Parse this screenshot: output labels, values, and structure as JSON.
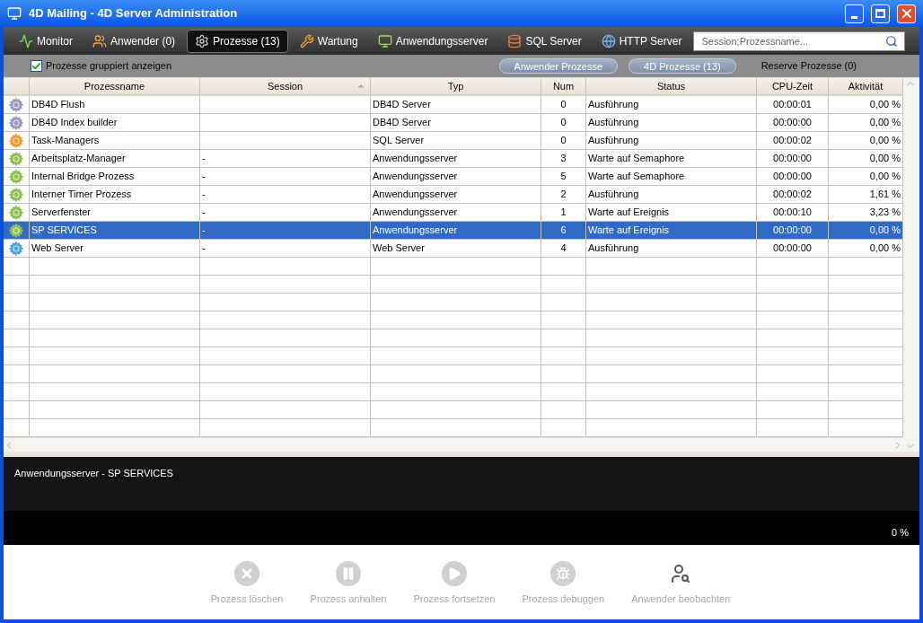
{
  "window": {
    "title": "4D Mailing - 4D Server Administration"
  },
  "tabs": [
    {
      "label": "Monitor",
      "kind": "monitor",
      "selected": false
    },
    {
      "label": "Anwender (0)",
      "kind": "users",
      "selected": false
    },
    {
      "label": "Prozesse (13)",
      "kind": "gear",
      "selected": true
    },
    {
      "label": "Wartung",
      "kind": "tools",
      "selected": false
    },
    {
      "label": "Anwendungsserver",
      "kind": "app",
      "selected": false
    },
    {
      "label": "SQL Server",
      "kind": "sql",
      "selected": false
    },
    {
      "label": "HTTP Server",
      "kind": "web",
      "selected": false
    }
  ],
  "search": {
    "placeholder": "Session;Prozessname..."
  },
  "group_option": {
    "label": "Prozesse gruppiert anzeigen",
    "checked": true
  },
  "filters": [
    {
      "label": "Anwender Prozesse",
      "kind": "pill"
    },
    {
      "label": "4D Prozesse (13)",
      "kind": "pill"
    },
    {
      "label": "Reserve Prozesse (0)",
      "kind": "text"
    }
  ],
  "table": {
    "columns": [
      {
        "label": "Prozessname",
        "sorted": false
      },
      {
        "label": "Session",
        "sorted": true
      },
      {
        "label": "Typ",
        "sorted": false
      },
      {
        "label": "Num",
        "sorted": false
      },
      {
        "label": "Status",
        "sorted": false
      },
      {
        "label": "CPU-Zeit",
        "sorted": false
      },
      {
        "label": "Aktivität",
        "sorted": false
      }
    ],
    "rows": [
      {
        "color": "#9a9ac0",
        "selected": false,
        "cells": [
          "DB4D Flush",
          "",
          "DB4D Server",
          "0",
          "Ausführung",
          "00:00:01",
          "0,00 %"
        ]
      },
      {
        "color": "#9a9ac0",
        "selected": false,
        "cells": [
          "DB4D Index builder",
          "",
          "DB4D Server",
          "0",
          "Ausführung",
          "00:00:00",
          "0,00 %"
        ]
      },
      {
        "color": "#f29a2e",
        "selected": false,
        "cells": [
          "Task-Managers",
          "",
          "SQL Server",
          "0",
          "Ausführung",
          "00:00:02",
          "0,00 %"
        ]
      },
      {
        "color": "#8cc152",
        "selected": false,
        "cells": [
          "Arbeitsplatz-Manager",
          "-",
          "Anwendungsserver",
          "3",
          "Warte auf Semaphore",
          "00:00:00",
          "0,00 %"
        ]
      },
      {
        "color": "#8cc152",
        "selected": false,
        "cells": [
          "Internal Bridge Prozess",
          "-",
          "Anwendungsserver",
          "5",
          "Warte auf Semaphore",
          "00:00:00",
          "0,00 %"
        ]
      },
      {
        "color": "#8cc152",
        "selected": false,
        "cells": [
          "Interner Timer Prozess",
          "-",
          "Anwendungsserver",
          "2",
          "Ausführung",
          "00:00:02",
          "1,61 %"
        ]
      },
      {
        "color": "#8cc152",
        "selected": false,
        "cells": [
          "Serverfenster",
          "-",
          "Anwendungsserver",
          "1",
          "Warte auf Ereignis",
          "00:00:10",
          "3,23 %"
        ]
      },
      {
        "color": "#8cc152",
        "selected": true,
        "cells": [
          "SP SERVICES",
          "-",
          "Anwendungsserver",
          "6",
          "Warte auf Ereignis",
          "00:00:00",
          "0,00 %"
        ]
      },
      {
        "color": "#4aa6e0",
        "selected": false,
        "cells": [
          "Web Server",
          "-",
          "Web Server",
          "4",
          "Ausführung",
          "00:00:00",
          "0,00 %"
        ]
      }
    ]
  },
  "details": {
    "text": "Anwendungsserver - SP SERVICES",
    "progress": {
      "reading": "0 %"
    }
  },
  "actions": [
    {
      "label": "Prozess löschen",
      "kind": "delete",
      "disabled": true
    },
    {
      "label": "Prozess anhalten",
      "kind": "pause",
      "disabled": true
    },
    {
      "label": "Prozess fortsetzen",
      "kind": "play",
      "disabled": true
    },
    {
      "label": "Prozess debuggen",
      "kind": "bug",
      "disabled": true
    },
    {
      "label": "Anwender beobachten",
      "kind": "watch",
      "disabled": true
    }
  ]
}
